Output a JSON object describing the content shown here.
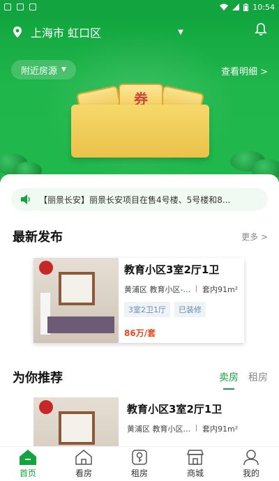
{
  "status_bar": {
    "time": "10:54"
  },
  "header": {
    "location": "上海市 虹口区",
    "nearby_button": "附近房源",
    "detail_link": "查看明细 >"
  },
  "banner": {
    "coupon_char": "券"
  },
  "notice": {
    "text": "【丽景长安】丽景长安项目在售4号楼、5号楼和8..."
  },
  "latest": {
    "title": "最新发布",
    "more": "更多 >",
    "listing": {
      "title": "教育小区3室2厅1卫",
      "location": "黄浦区 教育小区-...",
      "area": "套内91m²",
      "tags": [
        "3室2卫1厅",
        "已装修"
      ],
      "price": "86万/套"
    }
  },
  "recommend": {
    "title": "为你推荐",
    "tabs": [
      "卖房",
      "租房"
    ],
    "listing": {
      "title": "教育小区3室2厅1卫",
      "location": "黄浦区 教育小区...",
      "area": "套内91m²"
    }
  },
  "tabbar": {
    "items": [
      {
        "label": "首页",
        "icon": "home-icon",
        "active": true
      },
      {
        "label": "看房",
        "icon": "house-view-icon",
        "active": false
      },
      {
        "label": "租房",
        "icon": "rent-key-icon",
        "active": false
      },
      {
        "label": "商城",
        "icon": "shop-icon",
        "active": false
      },
      {
        "label": "我的",
        "icon": "profile-icon",
        "active": false
      }
    ]
  },
  "colors": {
    "brand_green": "#13a33f",
    "price_red": "#e9491f",
    "tag_blue": "#6b8bb0"
  }
}
